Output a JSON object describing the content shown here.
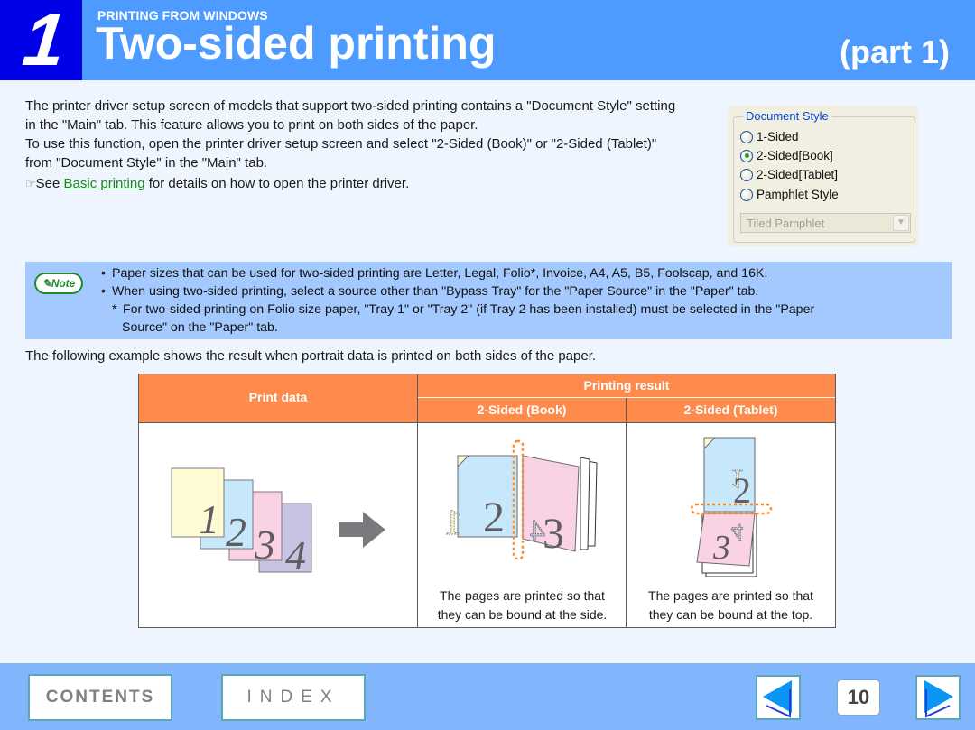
{
  "header": {
    "chapter_number": "1",
    "section": "PRINTING FROM WINDOWS",
    "title": "Two-sided printing",
    "part": "(part 1)"
  },
  "intro": {
    "line1": "The printer driver setup screen of models that support two-sided printing contains a \"Document Style\" setting in the \"Main\" tab. This feature allows you to print on both sides of the paper.",
    "line2": "To use this function, open the printer driver setup screen and select \"2-Sided (Book)\" or \"2-Sided (Tablet)\" from \"Document Style\" in the \"Main\" tab.",
    "ref_icon": "☞",
    "ref_prefix": "See ",
    "ref_link": "Basic printing",
    "ref_suffix": " for details on how to open the printer driver."
  },
  "dialog": {
    "group_title": "Document Style",
    "options": [
      {
        "label": "1-Sided",
        "checked": false
      },
      {
        "label": "2-Sided[Book]",
        "checked": true
      },
      {
        "label": "2-Sided[Tablet]",
        "checked": false
      },
      {
        "label": "Pamphlet Style",
        "checked": false
      }
    ],
    "dropdown_value": "Tiled Pamphlet",
    "dropdown_icon": "▼"
  },
  "note": {
    "badge": "Note",
    "badge_icon": "✎",
    "items": [
      {
        "mark": "•",
        "text": "Paper sizes that can be used for two-sided printing are Letter, Legal, Folio*, Invoice, A4, A5, B5, Foolscap, and 16K."
      },
      {
        "mark": "•",
        "text": "When using two-sided printing, select a source other than \"Bypass Tray\" for the \"Paper Source\" in the \"Paper\" tab."
      },
      {
        "mark": "*",
        "text": "For two-sided printing on Folio size paper, \"Tray 1\" or \"Tray 2\" (if Tray 2 has been installed) must be selected in the \"Paper"
      },
      {
        "mark": "",
        "text": "Source\" on the \"Paper\" tab."
      }
    ]
  },
  "example_text": "The following example shows the result when portrait data is printed on both sides of the paper.",
  "table": {
    "col_print_data": "Print data",
    "col_printing_result": "Printing result",
    "col_book": "2-Sided (Book)",
    "col_tablet": "2-Sided (Tablet)",
    "print_pages": [
      "1",
      "2",
      "3",
      "4"
    ],
    "book_caption_1": "The pages are printed so that",
    "book_caption_2": "they can be bound at the side.",
    "tablet_caption_1": "The pages are printed so that",
    "tablet_caption_2": "they can be bound at the top.",
    "colors": {
      "page1": "#fefbd4",
      "page2": "#c6e8fa",
      "page3": "#f9d3e3",
      "page4": "#c7c3e0",
      "binding": "#ff8a2a",
      "arrow": "#7a7a7e"
    }
  },
  "footer": {
    "contents": "CONTENTS",
    "index": "INDEX",
    "page_number": "10",
    "prev_icon": "left-arrow",
    "next_icon": "right-arrow"
  }
}
